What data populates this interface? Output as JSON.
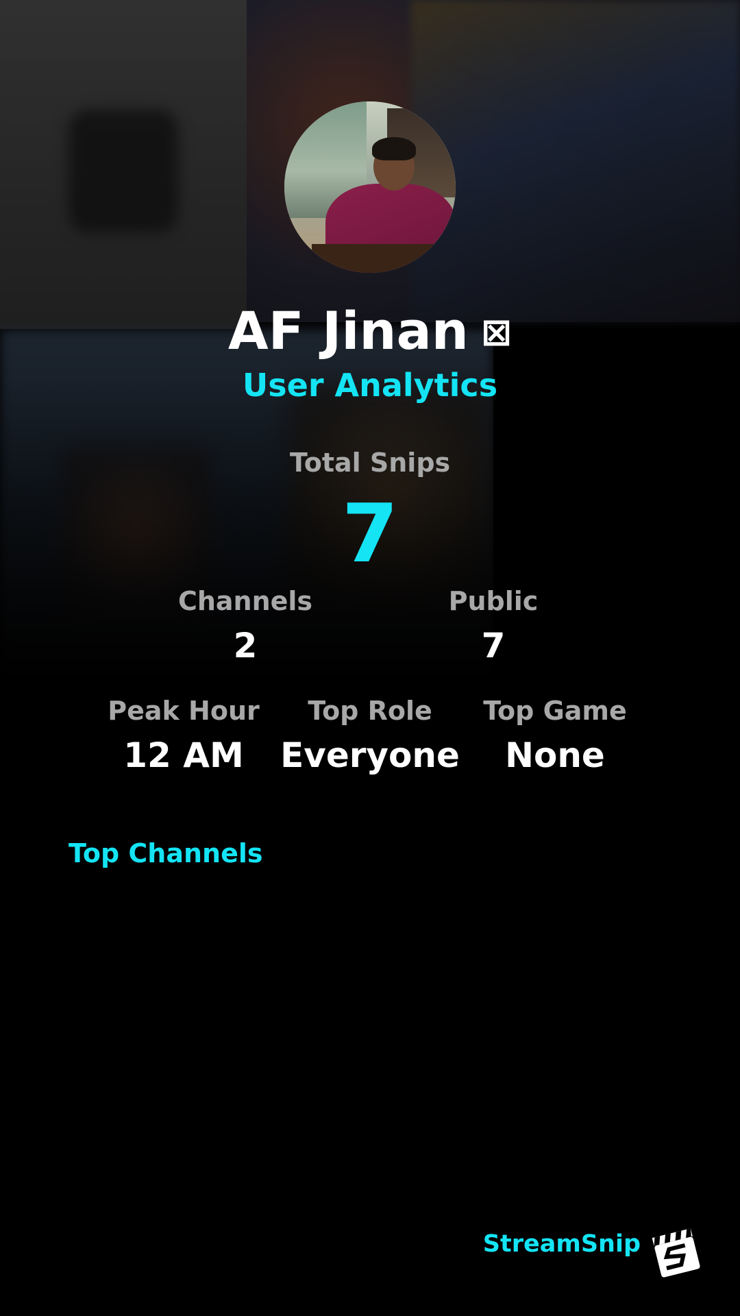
{
  "profile": {
    "name": "AF Jinan",
    "badge_glyph": "⊠",
    "subtitle": "User Analytics"
  },
  "stats": {
    "total_snips_label": "Total Snips",
    "total_snips_value": "7",
    "channels_label": "Channels",
    "channels_value": "2",
    "public_label": "Public",
    "public_value": "7",
    "peak_hour_label": "Peak Hour",
    "peak_hour_value": "12 AM",
    "top_role_label": "Top Role",
    "top_role_value": "Everyone",
    "top_game_label": "Top Game",
    "top_game_value": "None"
  },
  "sections": {
    "top_channels_title": "Top Channels"
  },
  "footer": {
    "brand": "StreamSnip",
    "logo_icon": "clapperboard-s-icon"
  },
  "colors": {
    "accent": "#14e4f4",
    "label_gray": "#a8a8a8",
    "value_white": "#ffffff",
    "background": "#000000"
  }
}
